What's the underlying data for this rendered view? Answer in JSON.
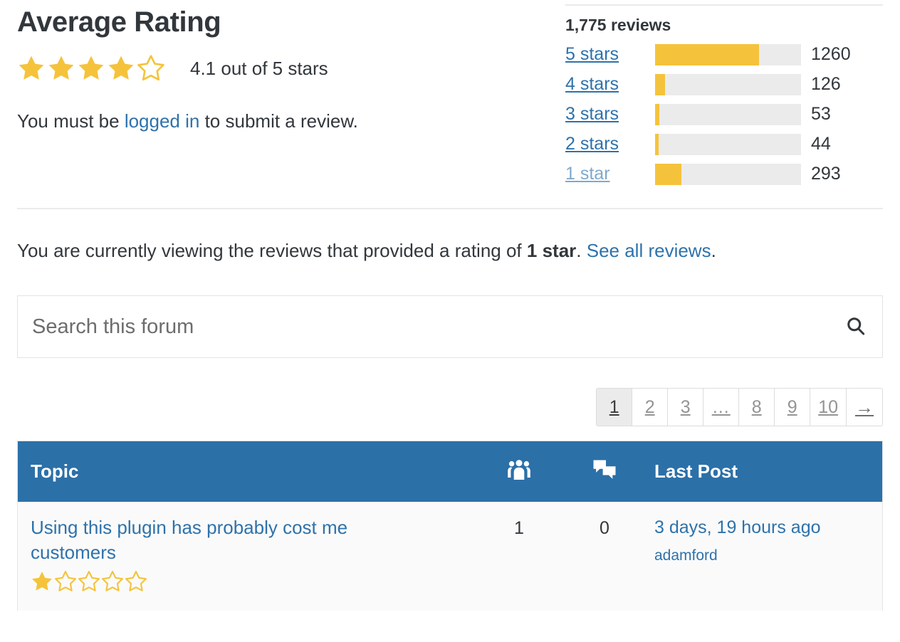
{
  "header": {
    "title": "Average Rating",
    "average_text": "4.1 out of 5 stars",
    "average_value": 4.1,
    "max_stars": 5,
    "filled_stars": 4
  },
  "login_notice": {
    "prefix": "You must be ",
    "link": "logged in",
    "suffix": " to submit a review."
  },
  "summary": {
    "reviews_count_label": "1,775 reviews",
    "total_reviews": 1775
  },
  "filter_notice": {
    "prefix": "You are currently viewing the reviews that provided a rating of ",
    "emphasis": "1 star",
    "middle": ". ",
    "link": "See all reviews",
    "suffix": "."
  },
  "search": {
    "placeholder": "Search this forum",
    "value": "",
    "icon": "search-icon"
  },
  "pagination": {
    "items": [
      {
        "label": "1",
        "current": true,
        "type": "page"
      },
      {
        "label": "2",
        "current": false,
        "type": "page"
      },
      {
        "label": "3",
        "current": false,
        "type": "page"
      },
      {
        "label": "…",
        "current": false,
        "type": "dots"
      },
      {
        "label": "8",
        "current": false,
        "type": "page"
      },
      {
        "label": "9",
        "current": false,
        "type": "page"
      },
      {
        "label": "10",
        "current": false,
        "type": "page"
      },
      {
        "label": "→",
        "current": false,
        "type": "next"
      }
    ]
  },
  "table": {
    "columns": {
      "topic": "Topic",
      "voices_icon": "voices-people-icon",
      "posts_icon": "posts-speech-bubbles-icon",
      "last_post": "Last Post"
    },
    "rows": [
      {
        "topic": "Using this plugin has probably cost me customers",
        "rating": 1,
        "max_stars": 5,
        "voices": "1",
        "posts": "0",
        "last_post_time": "3 days, 19 hours ago",
        "last_post_author": "adamford"
      }
    ]
  },
  "colors": {
    "star_gold": "#f5c33b",
    "link_blue": "#2e72ab",
    "link_blue_muted": "#7fa9cc",
    "header_blue": "#2c70a8",
    "track_grey": "#ebebeb",
    "text_dark": "#32373c"
  },
  "chart_data": {
    "type": "bar",
    "title": "1,775 reviews",
    "orientation": "horizontal",
    "categories": [
      "5 stars",
      "4 stars",
      "3 stars",
      "2 stars",
      "1 star"
    ],
    "values": [
      1260,
      126,
      53,
      44,
      293
    ],
    "value_labels": [
      "1260",
      "126",
      "53",
      "44",
      "293"
    ],
    "percent_of_max": [
      71,
      7,
      3,
      2.5,
      18
    ],
    "current_filter": "1 star",
    "xlabel": "",
    "ylabel": "",
    "grid": false,
    "legend": "none",
    "bar_color": "#f5c33b",
    "track_color": "#ebebeb"
  }
}
